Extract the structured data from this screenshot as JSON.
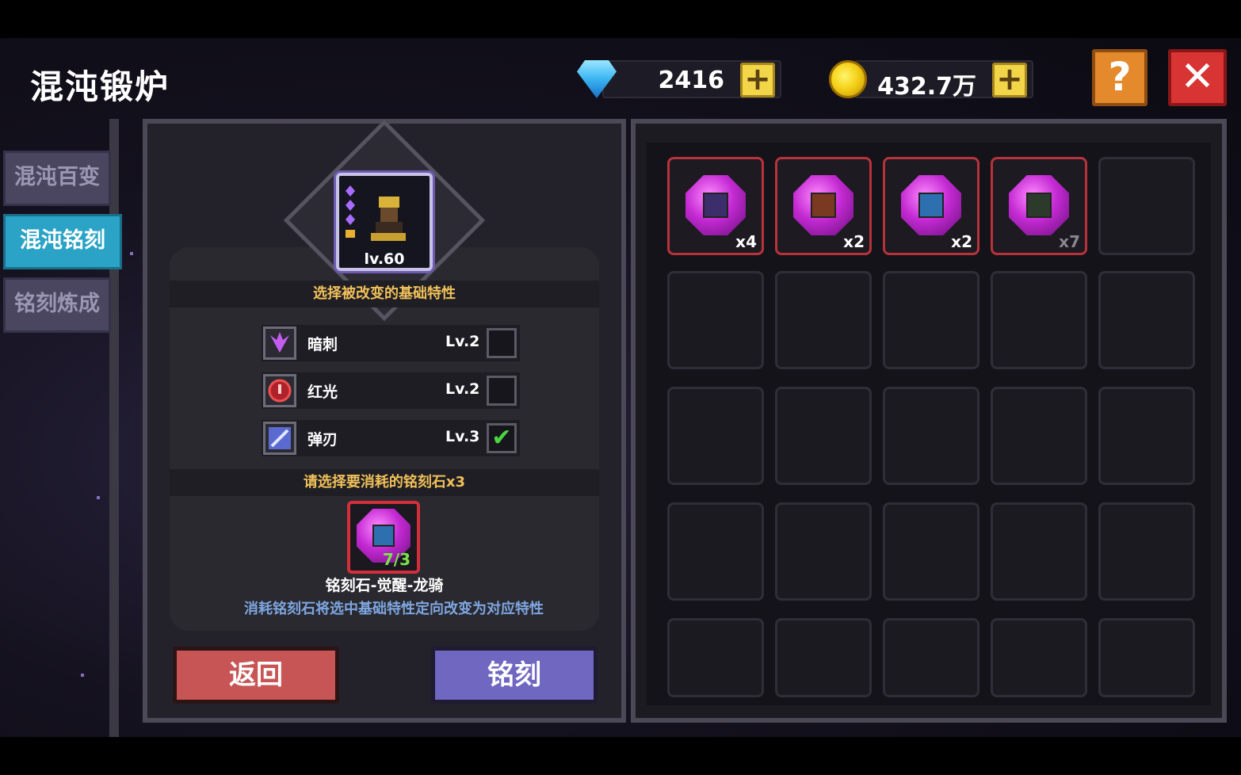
{
  "header": {
    "title": "混沌锻炉",
    "gems": "2416",
    "coins": "432.7万",
    "plus_label": "+",
    "help_label": "?",
    "close_label": "✕"
  },
  "sidebar": {
    "tabs": [
      {
        "label": "混沌百变",
        "active": false
      },
      {
        "label": "混沌铭刻",
        "active": true
      },
      {
        "label": "铭刻炼成",
        "active": false
      }
    ]
  },
  "hero": {
    "level": "lv.60"
  },
  "traits_section": {
    "heading": "选择被改变的基础特性",
    "traits": [
      {
        "name": "暗刺",
        "level": "Lv.2",
        "checked": false,
        "icon": "dark-thorn-icon",
        "check": ""
      },
      {
        "name": "红光",
        "level": "Lv.2",
        "checked": false,
        "icon": "red-light-icon",
        "check": ""
      },
      {
        "name": "弹刃",
        "level": "Lv.3",
        "checked": true,
        "icon": "bounce-blade-icon",
        "check": "✔"
      }
    ]
  },
  "stone_section": {
    "heading": "请选择要消耗的铭刻石x3",
    "count": "7/3",
    "stone_name": "铭刻石-觉醒-龙骑",
    "description": "消耗铭刻石将选中基础特性定向改变为对应特性"
  },
  "buttons": {
    "back": "返回",
    "engrave": "铭刻"
  },
  "inventory": {
    "items": [
      {
        "icon": "blades-stone-icon",
        "qty": "x4",
        "core_color": "#3b2e6a"
      },
      {
        "icon": "brown-stone-icon",
        "qty": "x2",
        "core_color": "#7a3a22"
      },
      {
        "icon": "blue-dragon-stone-icon",
        "qty": "x2",
        "core_color": "#2e6fb0"
      },
      {
        "icon": "selected-stone-icon",
        "qty": "x7",
        "core_color": "#2b3a2a"
      }
    ],
    "total_slots": 25
  },
  "colors": {
    "active_tab": "#2ba3c6",
    "back_button": "#c85555",
    "engrave_button": "#6f67c0",
    "section_text": "#f0c05a",
    "desc_text": "#7ea6e0"
  }
}
